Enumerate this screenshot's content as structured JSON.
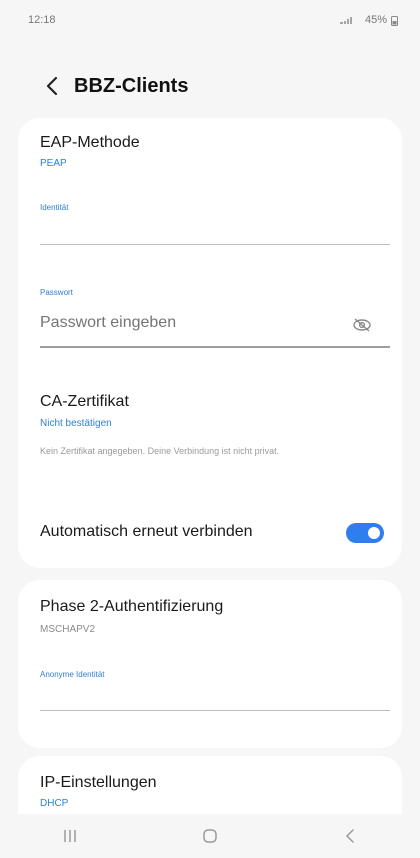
{
  "status_bar": {
    "time": "12:18",
    "battery": "45%"
  },
  "header": {
    "title": "BBZ-Clients"
  },
  "eap": {
    "label": "EAP-Methode",
    "value": "PEAP"
  },
  "identity": {
    "label": "Identität",
    "value": ""
  },
  "password": {
    "label": "Passwort",
    "placeholder": "Passwort eingeben"
  },
  "ca": {
    "label": "CA-Zertifikat",
    "value": "Nicht bestätigen",
    "hint": "Kein Zertifikat angegeben. Deine Verbindung ist nicht privat."
  },
  "auto_reconnect": {
    "label": "Automatisch erneut verbinden",
    "enabled": true
  },
  "phase2": {
    "label": "Phase 2-Authentifizierung",
    "value": "MSCHAPV2"
  },
  "anon_identity": {
    "label": "Anonyme Identität",
    "value": ""
  },
  "ip": {
    "label": "IP-Einstellungen",
    "value": "DHCP"
  },
  "nav": {
    "recent": "recent-apps-icon",
    "home": "home-icon",
    "back": "back-nav-icon"
  },
  "colors": {
    "accent": "#2f7ef0",
    "link": "#2f7fd0",
    "card": "#ffffff",
    "background": "#f6f6f6"
  }
}
